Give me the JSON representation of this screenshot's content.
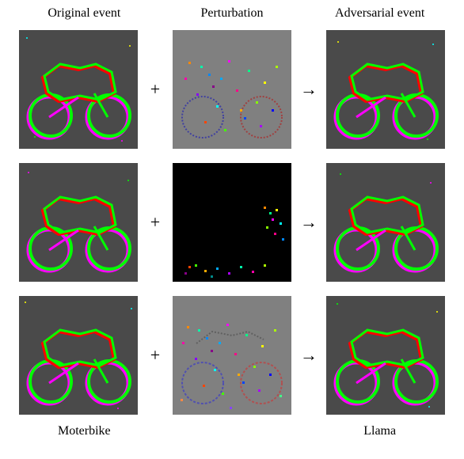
{
  "headers": {
    "original": "Original event",
    "perturbation": "Perturbation",
    "adversarial": "Adversarial event"
  },
  "operators": {
    "plus": "+",
    "arrow": "→"
  },
  "footer": {
    "left": "Moterbike",
    "right": "Llama"
  },
  "rows": [
    {
      "original": "event-motorbike",
      "perturbation_style": "gray-noise",
      "adversarial": "event-motorbike"
    },
    {
      "original": "event-motorbike",
      "perturbation_style": "black-sparse",
      "adversarial": "event-motorbike"
    },
    {
      "original": "event-motorbike",
      "perturbation_style": "gray-noise",
      "adversarial": "event-motorbike"
    }
  ]
}
